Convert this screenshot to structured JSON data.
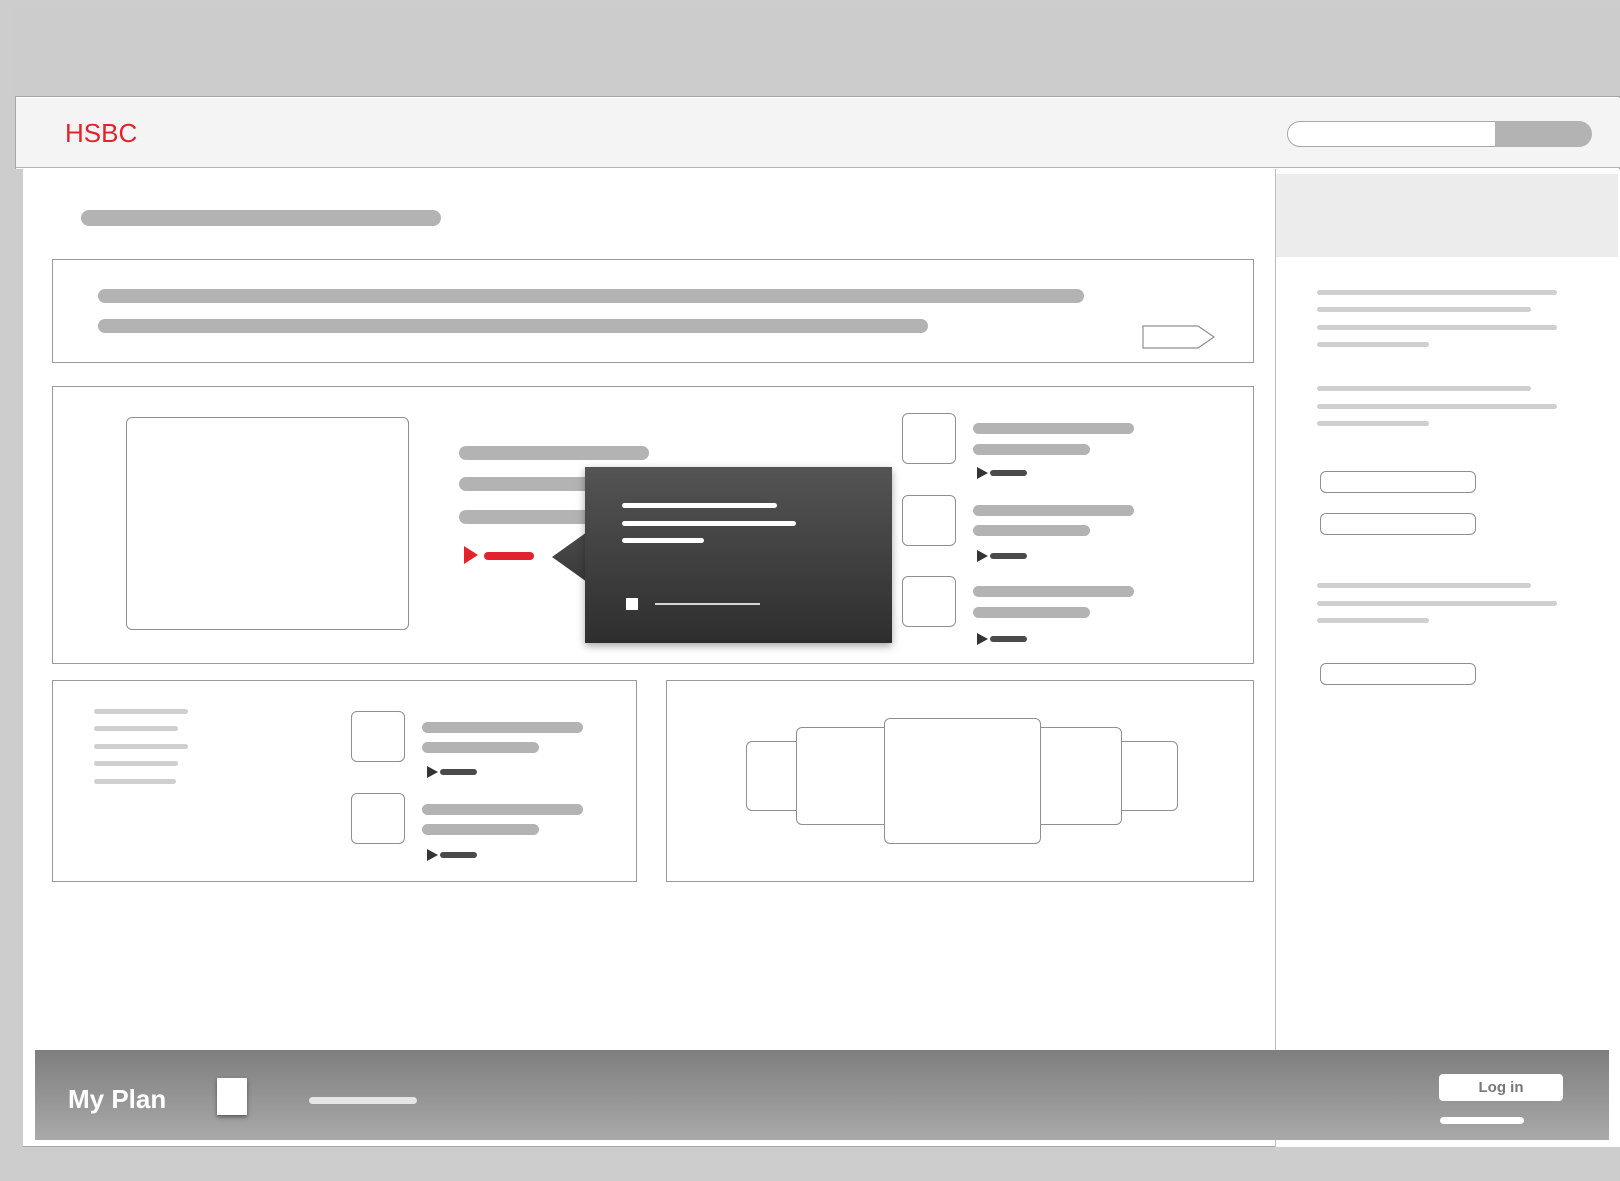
{
  "brand": {
    "name": "HSBC",
    "color": "#e3232b"
  },
  "colors": {
    "accent": "#e3232b",
    "placeholder": "#b3b3b3",
    "frame": "#cdcdcd",
    "footer_dark": "#7f7f7f",
    "popover": "#3a3a3a"
  },
  "header": {
    "search": {
      "placeholder": "",
      "button_label": ""
    }
  },
  "popover": {
    "checkbox_checked": false
  },
  "footer": {
    "title": "My Plan",
    "login_label": "Log in"
  },
  "icons": [
    "play-triangle-icon",
    "arrow-tag-icon",
    "checkbox-icon"
  ]
}
